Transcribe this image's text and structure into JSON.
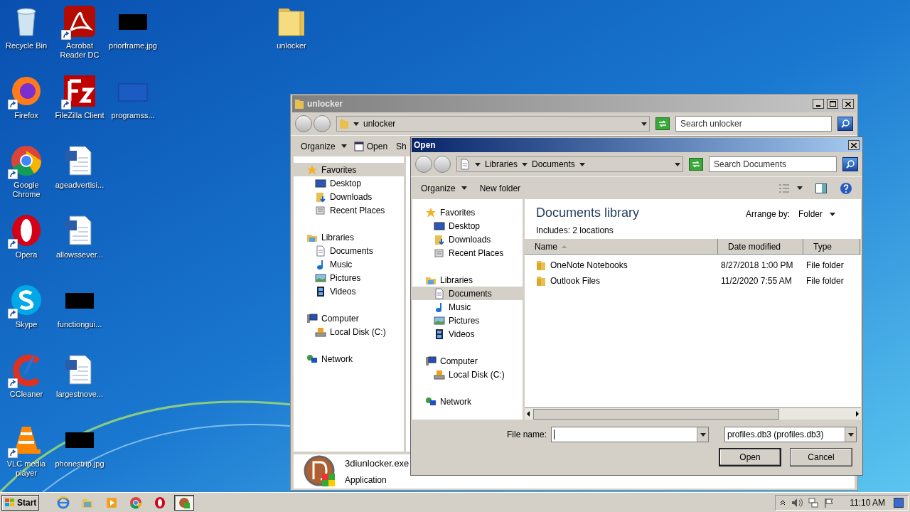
{
  "desktop": {
    "columns": [
      [
        {
          "label": "Recycle Bin",
          "kind": "recycle",
          "shortcut": false
        },
        {
          "label": "Firefox",
          "kind": "firefox",
          "shortcut": true
        },
        {
          "label": "Google Chrome",
          "kind": "chrome",
          "shortcut": true
        },
        {
          "label": "Opera",
          "kind": "opera",
          "shortcut": true
        },
        {
          "label": "Skype",
          "kind": "skype",
          "shortcut": true
        },
        {
          "label": "CCleaner",
          "kind": "ccleaner",
          "shortcut": true
        },
        {
          "label": "VLC media player",
          "kind": "vlc",
          "shortcut": true
        }
      ],
      [
        {
          "label": "Acrobat Reader DC",
          "kind": "acrobat",
          "shortcut": true
        },
        {
          "label": "FileZilla Client",
          "kind": "filezilla",
          "shortcut": true
        },
        {
          "label": "ageadvertisi...",
          "kind": "word",
          "shortcut": false
        },
        {
          "label": "allowssever...",
          "kind": "word",
          "shortcut": false
        },
        {
          "label": "functiongui...",
          "kind": "image",
          "shortcut": false
        },
        {
          "label": "largestnove...",
          "kind": "word",
          "shortcut": false
        },
        {
          "label": "phonestrip.jpg",
          "kind": "image",
          "shortcut": false
        }
      ],
      [
        {
          "label": "priorframe.jpg",
          "kind": "image",
          "shortcut": false
        },
        {
          "label": "programss...",
          "kind": "blank",
          "shortcut": false
        }
      ],
      [
        {
          "label": "unlocker",
          "kind": "folder",
          "shortcut": false
        }
      ]
    ]
  },
  "explorer": {
    "title": "unlocker",
    "address": "unlocker",
    "search": {
      "placeholder": "Search unlocker"
    },
    "toolbar": [
      "Organize",
      "Open",
      "Sh"
    ],
    "nav": [
      {
        "label": "Favorites",
        "kind": "star",
        "selected": true,
        "children": [
          {
            "label": "Desktop",
            "kind": "desktop",
            "selected": false
          },
          {
            "label": "Downloads",
            "kind": "downloads",
            "selected": false
          },
          {
            "label": "Recent Places",
            "kind": "recent",
            "selected": false
          }
        ]
      },
      {
        "label": "Libraries",
        "kind": "libraries",
        "selected": false,
        "children": [
          {
            "label": "Documents",
            "kind": "documents",
            "selected": false
          },
          {
            "label": "Music",
            "kind": "music",
            "selected": false
          },
          {
            "label": "Pictures",
            "kind": "pictures",
            "selected": false
          },
          {
            "label": "Videos",
            "kind": "videos",
            "selected": false
          }
        ]
      },
      {
        "label": "Computer",
        "kind": "computer",
        "selected": false,
        "children": [
          {
            "label": "Local Disk (C:)",
            "kind": "disk",
            "selected": false
          }
        ]
      },
      {
        "label": "Network",
        "kind": "network",
        "selected": false
      }
    ],
    "details": {
      "name": "3diunlocker.exe",
      "type": "Application"
    }
  },
  "dialog": {
    "title": "Open",
    "path": [
      "Libraries",
      "Documents"
    ],
    "search": {
      "placeholder": "Search Documents"
    },
    "toolbar": [
      "Organize",
      "New folder"
    ],
    "nav": [
      {
        "label": "Favorites",
        "kind": "star",
        "selected": false,
        "children": [
          {
            "label": "Desktop",
            "kind": "desktop",
            "selected": false
          },
          {
            "label": "Downloads",
            "kind": "downloads",
            "selected": false
          },
          {
            "label": "Recent Places",
            "kind": "recent",
            "selected": false
          }
        ]
      },
      {
        "label": "Libraries",
        "kind": "libraries",
        "selected": false,
        "children": [
          {
            "label": "Documents",
            "kind": "documents",
            "selected": true
          },
          {
            "label": "Music",
            "kind": "music",
            "selected": false
          },
          {
            "label": "Pictures",
            "kind": "pictures",
            "selected": false
          },
          {
            "label": "Videos",
            "kind": "videos",
            "selected": false
          }
        ]
      },
      {
        "label": "Computer",
        "kind": "computer",
        "selected": false,
        "children": [
          {
            "label": "Local Disk (C:)",
            "kind": "disk",
            "selected": false
          }
        ]
      },
      {
        "label": "Network",
        "kind": "network",
        "selected": false
      }
    ],
    "library": {
      "title": "Documents library",
      "includes": "Includes:  2 locations",
      "arrange_label": "Arrange by:",
      "arrange_value": "Folder"
    },
    "columns": [
      "Name",
      "Date modified",
      "Type"
    ],
    "rows": [
      {
        "name": "OneNote Notebooks",
        "date": "8/27/2018 1:00 PM",
        "type": "File folder"
      },
      {
        "name": "Outlook Files",
        "date": "11/2/2020 7:55 AM",
        "type": "File folder"
      }
    ],
    "file_name_label": "File name:",
    "filter": "profiles.db3 (profiles.db3)",
    "buttons": [
      "Open",
      "Cancel"
    ]
  },
  "taskbar": {
    "start": "Start",
    "apps": [
      {
        "kind": "ie",
        "selected": false
      },
      {
        "kind": "explorer",
        "selected": false
      },
      {
        "kind": "media",
        "selected": false
      },
      {
        "kind": "chrome",
        "selected": false
      },
      {
        "kind": "opera",
        "selected": false
      },
      {
        "kind": "app",
        "selected": true
      }
    ],
    "clock": "11:10 AM"
  }
}
